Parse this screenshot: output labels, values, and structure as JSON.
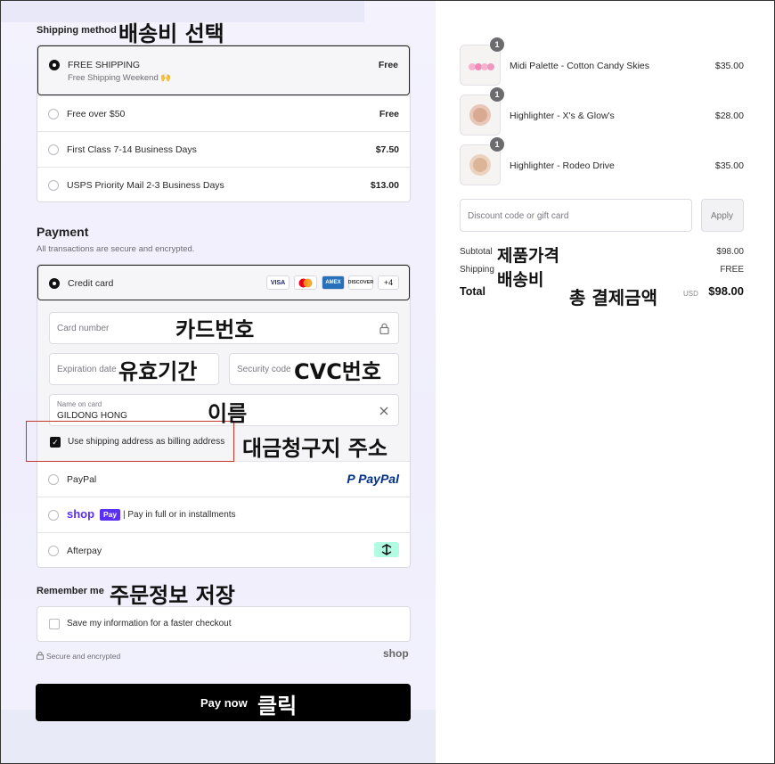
{
  "shipping": {
    "title": "Shipping method",
    "annotation": "배송비 선택",
    "options": [
      {
        "label": "FREE SHIPPING",
        "sub": "Free Shipping Weekend 🙌",
        "price": "Free"
      },
      {
        "label": "Free over $50",
        "price": "Free"
      },
      {
        "label": "First Class 7-14 Business Days",
        "price": "$7.50"
      },
      {
        "label": "USPS Priority Mail 2-3 Business Days",
        "price": "$13.00"
      }
    ]
  },
  "payment": {
    "title": "Payment",
    "subtitle": "All transactions are secure and encrypted.",
    "credit_label": "Credit card",
    "card_brands": [
      "VISA",
      "MC",
      "AMEX",
      "DISCOVER",
      "+4"
    ],
    "card_number_ph": "Card number",
    "card_number_ann": "카드번호",
    "expiry_ph": "Expiration date",
    "expiry_ann": "유효기간",
    "cvc_ph": "Security code",
    "cvc_ann": "CVC번호",
    "name_label": "Name on card",
    "name_value": "GILDONG HONG",
    "name_ann": "이름",
    "billing_label": "Use shipping address as billing address",
    "billing_ann": "대금청구지 주소",
    "paypal_label": "PayPal",
    "paypal_logo": "PayPal",
    "shop_label": "| Pay in full or in installments",
    "shop_logo": "shop",
    "shop_pay": "Pay",
    "afterpay_label": "Afterpay"
  },
  "remember": {
    "title": "Remember me",
    "annotation": "주문정보 저장",
    "save_label": "Save my information for a faster checkout",
    "secure_text": "Secure and encrypted",
    "shop_logo": "shop"
  },
  "pay_now": {
    "label": "Pay now",
    "annotation": "클릭"
  },
  "cart": {
    "items": [
      {
        "qty": "1",
        "name": "Midi Palette - Cotton Candy Skies",
        "price": "$35.00"
      },
      {
        "qty": "1",
        "name": "Highlighter - X's & Glow's",
        "price": "$28.00"
      },
      {
        "qty": "1",
        "name": "Highlighter - Rodeo Drive",
        "price": "$35.00"
      }
    ],
    "discount_ph": "Discount code or gift card",
    "apply_label": "Apply",
    "subtotal_label": "Subtotal",
    "subtotal_ann": "제품가격",
    "subtotal_value": "$98.00",
    "shipping_label": "Shipping",
    "shipping_ann": "배송비",
    "shipping_value": "FREE",
    "total_label": "Total",
    "total_ann": "총 결제금액",
    "currency": "USD",
    "total_value": "$98.00"
  },
  "colors": {
    "left_bg": "#f1f0fc",
    "shop_purple": "#5a31f4",
    "paypal_dark": "#003087",
    "paypal_light": "#009cde",
    "afterpay_mint": "#b2fce4",
    "annotation_box": "#c0392b"
  }
}
